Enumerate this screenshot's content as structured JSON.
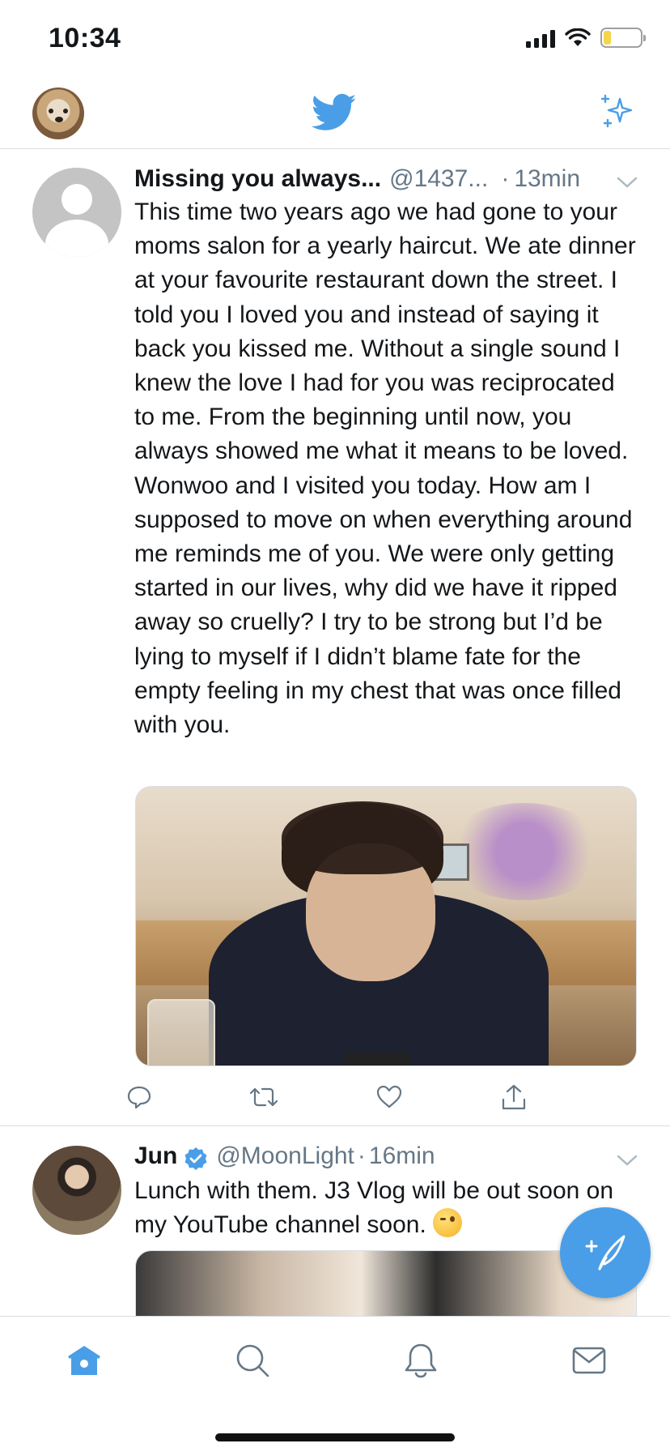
{
  "status_bar": {
    "time": "10:34",
    "battery_level": 0.2,
    "battery_color": "#f5d54a"
  },
  "header": {
    "logo_icon": "twitter-bird-icon",
    "top_tweets_icon": "sparkle-icon",
    "brand_color": "#4a9ee8"
  },
  "tweets": [
    {
      "name": "Missing you always...",
      "handle": "@1437...",
      "dot": "·",
      "time": "13min",
      "text": "This time two years ago we had gone to your moms salon for a yearly haircut. We ate dinner at your favourite restaurant down the street. I told you I loved you and instead of saying it back you kissed me. Without a single sound I knew the love I had for you was reciprocated to me. From the beginning until now, you always showed me what it means to be loved. Wonwoo and I visited you today. How am I supposed to move on when everything around me reminds me of you. We were only getting started in our lives, why did we have it ripped away so cruelly? I try to be strong but I’d be lying to myself if I didn’t blame fate for the empty feeling in my chest that was once filled with you.",
      "has_media": true
    },
    {
      "name": "Jun",
      "verified": true,
      "handle": "@MoonLight",
      "dot": "·",
      "time": "16min",
      "text": "Lunch with them. J3 Vlog will be out soon on my YouTube channel soon.",
      "emoji": "wink-emoji",
      "has_media": true
    }
  ],
  "actions": [
    "reply-icon",
    "retweet-icon",
    "like-icon",
    "share-icon"
  ],
  "tab_bar": {
    "items": [
      "home-icon",
      "search-icon",
      "notifications-icon",
      "messages-icon"
    ],
    "active": "home-icon"
  },
  "colors": {
    "accent": "#4a9ee8",
    "secondary_text": "#657786",
    "divider": "#d9dde1"
  }
}
